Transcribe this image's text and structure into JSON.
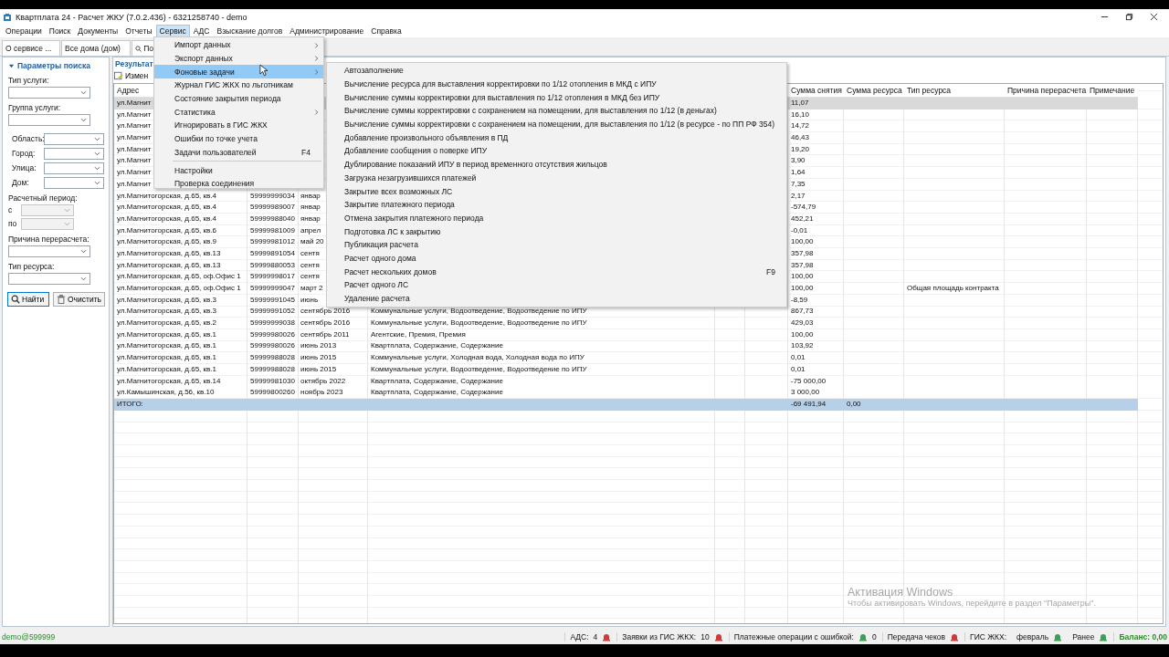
{
  "window": {
    "title": "Квартплата 24 - Расчет ЖКУ (7.0.2.436) - 6321258740 - demo"
  },
  "menu_bar": [
    {
      "label": "Операции",
      "selected": false
    },
    {
      "label": "Поиск",
      "selected": false
    },
    {
      "label": "Документы",
      "selected": false
    },
    {
      "label": "Отчеты",
      "selected": false
    },
    {
      "label": "Сервис",
      "selected": true
    },
    {
      "label": "АДС",
      "selected": false
    },
    {
      "label": "Взыскание долгов",
      "selected": false
    },
    {
      "label": "Администрирование",
      "selected": false
    },
    {
      "label": "Справка",
      "selected": false
    }
  ],
  "tabs": [
    {
      "label": "О сервисе ...",
      "kind": "plain"
    },
    {
      "label": "Все дома (дом)",
      "kind": "plain"
    },
    {
      "label": "По",
      "kind": "search"
    }
  ],
  "service_menu": [
    {
      "kind": "item",
      "label": "Импорт данных",
      "has_submenu": true,
      "selected": false
    },
    {
      "kind": "item",
      "label": "Экспорт данных",
      "has_submenu": true,
      "selected": false
    },
    {
      "kind": "item",
      "label": "Фоновые задачи",
      "has_submenu": true,
      "selected": true
    },
    {
      "kind": "item",
      "label": "Журнал ГИС ЖКХ по льготникам",
      "has_submenu": false,
      "selected": false
    },
    {
      "kind": "item",
      "label": "Состояние закрытия периода",
      "has_submenu": false,
      "selected": false
    },
    {
      "kind": "item",
      "label": "Статистика",
      "has_submenu": true,
      "selected": false
    },
    {
      "kind": "item",
      "label": "Игнорировать в ГИС ЖКХ",
      "has_submenu": false,
      "selected": false
    },
    {
      "kind": "item",
      "label": "Ошибки по точке учета",
      "has_submenu": false,
      "selected": false
    },
    {
      "kind": "item",
      "label": "Задачи пользователей",
      "shortcut": "F4",
      "has_submenu": false,
      "selected": false
    },
    {
      "kind": "separator"
    },
    {
      "kind": "item",
      "label": "Настройки",
      "has_submenu": false,
      "selected": false
    },
    {
      "kind": "item",
      "label": "Проверка соединения",
      "has_submenu": false,
      "selected": false
    }
  ],
  "background_tasks_menu": [
    {
      "label": "Автозаполнение"
    },
    {
      "label": "Вычисление ресурса для выставления корректировки по 1/12 отопления в МКД с ИПУ"
    },
    {
      "label": "Вычисление суммы корректировки  для выставления по 1/12 отопления в МКД без ИПУ"
    },
    {
      "label": "Вычисление суммы корректировки с сохранением на помещении, для выставления по 1/12 (в деньгах)"
    },
    {
      "label": "Вычисление суммы корректировки с сохранением на помещении, для выставления по 1/12 (в ресурсе - по ПП РФ 354)"
    },
    {
      "label": "Добавление произвольного объявления в ПД"
    },
    {
      "label": "Добавление сообщения о поверке ИПУ"
    },
    {
      "label": "Дублирование показаний ИПУ в период временного отсутствия жильцов"
    },
    {
      "label": "Загрузка незагрузившихся платежей"
    },
    {
      "label": "Закрытие всех возможных ЛС"
    },
    {
      "label": "Закрытие платежного периода"
    },
    {
      "label": "Отмена закрытия платежного периода"
    },
    {
      "label": "Подготовка ЛС к закрытию"
    },
    {
      "label": "Публикация расчета"
    },
    {
      "label": "Расчет  одного дома"
    },
    {
      "label": "Расчет нескольких домов",
      "shortcut": "F9"
    },
    {
      "label": "Расчет одного ЛС"
    },
    {
      "label": "Удаление расчета"
    }
  ],
  "search_panel": {
    "title": "Параметры поиска",
    "service_fields": [
      {
        "label": "Тип услуги:"
      },
      {
        "label": "Группа услуги:"
      }
    ],
    "address_fields": [
      {
        "label": "Область:"
      },
      {
        "label": "Город:"
      },
      {
        "label": "Улица:"
      },
      {
        "label": "Дом:"
      }
    ],
    "period": {
      "label": "Расчетный период:",
      "fields": [
        {
          "label": "с",
          "disabled": true
        },
        {
          "label": "по",
          "disabled": true
        }
      ]
    },
    "extra_fields": [
      {
        "label": "Причина перерасчета:"
      },
      {
        "label": "Тип ресурса:"
      }
    ],
    "buttons": [
      {
        "label": "Найти",
        "kind": "search"
      },
      {
        "label": "Очистить",
        "kind": "clear"
      }
    ]
  },
  "results": {
    "title": "Результат",
    "edit_button": "Измен",
    "table": {
      "columns": [
        "Адрес",
        "Сумма снятия",
        "Сумма ресурса",
        "Тип ресурса",
        "Причина перерасчета",
        "Примечание"
      ],
      "rows": [
        {
          "address": "ул.Магнит",
          "sum": "11,07",
          "selected": true
        },
        {
          "address": "ул.Магнит",
          "sum": "16,10",
          "selected": false
        },
        {
          "address": "ул.Магнит",
          "sum": "14,72",
          "selected": false
        },
        {
          "address": "ул.Магнит",
          "sum": "46,43",
          "selected": false
        },
        {
          "address": "ул.Магнит",
          "sum": "19,20",
          "selected": false
        },
        {
          "address": "ул.Магнит",
          "sum": "3,90",
          "selected": false
        },
        {
          "address": "ул.Магнит",
          "sum": "1,64",
          "selected": false
        },
        {
          "address": "ул.Магнит",
          "sum": "7,35",
          "selected": false
        },
        {
          "address": "ул.Магнитогорская, д.65, кв.4",
          "account": "59999999034",
          "period": "январ",
          "sum": "2,17",
          "selected": false
        },
        {
          "address": "ул.Магнитогорская, д.65, кв.4",
          "account": "59999989007",
          "period": "январ",
          "sum": "-574,79",
          "selected": false
        },
        {
          "address": "ул.Магнитогорская, д.65, кв.4",
          "account": "59999988040",
          "period": "январ",
          "sum": "452,21",
          "selected": false
        },
        {
          "address": "ул.Магнитогорская, д.65, кв.6",
          "account": "59999981009",
          "period": "апрел",
          "sum": "-0,01",
          "selected": false
        },
        {
          "address": "ул.Магнитогорская, д.65, кв.9",
          "account": "59999981012",
          "period": "май 20",
          "sum": "100,00",
          "selected": false
        },
        {
          "address": "ул.Магнитогорская, д.65, кв.13",
          "account": "59999891054",
          "period": "сентя",
          "sum": "357,98",
          "selected": false
        },
        {
          "address": "ул.Магнитогорская, д.65, кв.13",
          "account": "59999880053",
          "period": "сентя",
          "sum": "357,98",
          "selected": false
        },
        {
          "address": "ул.Магнитогорская, д.65, оф.Офис 1",
          "account": "59999998017",
          "period": "сентя",
          "sum": "100,00",
          "selected": false
        },
        {
          "address": "ул.Магнитогорская, д.65, оф.Офис 1",
          "account": "59999999047",
          "period": "март 2",
          "sum": "100,00",
          "resource_type": "Общая площадь контракта",
          "selected": false
        },
        {
          "address": "ул.Магнитогорская, д.65, кв.3",
          "account": "59999991045",
          "period": "июнь",
          "sum": "-8,59",
          "selected": false
        },
        {
          "address": "ул.Магнитогорская, д.65, кв.3",
          "account": "59999991052",
          "period": "сентябрь 2016",
          "services": "Коммунальные услуги, Водоотведение, Водоотведение по ИПУ",
          "sum": "867,73",
          "selected": false
        },
        {
          "address": "ул.Магнитогорская, д.65, кв.2",
          "account": "59999999038",
          "period": "сентябрь 2016",
          "services": "Коммунальные услуги, Водоотведение, Водоотведение по ИПУ",
          "sum": "429,03",
          "selected": false
        },
        {
          "address": "ул.Магнитогорская, д.65, кв.1",
          "account": "59999980026",
          "period": "сентябрь 2011",
          "services": "Агентские, Премия, Премия",
          "sum": "100,00",
          "selected": false
        },
        {
          "address": "ул.Магнитогорская, д.65, кв.1",
          "account": "59999980026",
          "period": "июнь 2013",
          "services": "Квартплата, Содержание, Содержание",
          "sum": "103,92",
          "selected": false
        },
        {
          "address": "ул.Магнитогорская, д.65, кв.1",
          "account": "59999988028",
          "period": "июнь 2015",
          "services": "Коммунальные услуги, Холодная вода, Холодная вода по ИПУ",
          "sum": "0,01",
          "selected": false
        },
        {
          "address": "ул.Магнитогорская, д.65, кв.1",
          "account": "59999988028",
          "period": "июнь 2015",
          "services": "Коммунальные услуги, Водоотведение, Водоотведение по ИПУ",
          "sum": "0,01",
          "selected": false
        },
        {
          "address": "ул.Магнитогорская, д.65, кв.14",
          "account": "59999981030",
          "period": "октябрь 2022",
          "services": "Квартплата, Содержание, Содержание",
          "sum": "-75 000,00",
          "selected": false
        },
        {
          "address": "ул.Камышинская, д.56, кв.10",
          "account": "59999800260",
          "period": "ноябрь 2023",
          "services": "Квартплата, Содержание, Содержание",
          "sum": "3 000,00",
          "selected": false
        }
      ],
      "total": {
        "label": "ИТОГО:",
        "sum": "-69 491,94",
        "resource_sum": "0,00"
      }
    }
  },
  "status_bar": {
    "user": "demo@599999",
    "indicators": [
      {
        "kind": "value_icon",
        "label": "АДС:",
        "value": "4",
        "color": "#d23a3a"
      },
      {
        "kind": "value_icon",
        "label": "Заявки из ГИС ЖКХ:",
        "value": "10",
        "color": "#d23a3a"
      },
      {
        "kind": "icon_value",
        "label": "Платежные операции с ошибкой:",
        "value": "0",
        "color": "#3aa055"
      },
      {
        "kind": "icon",
        "label": "Передача чеков",
        "color": "#d23a3a"
      },
      {
        "kind": "text",
        "label": "ГИС ЖКХ:"
      },
      {
        "kind": "icon",
        "label": "февраль",
        "color": "#3aa055"
      },
      {
        "kind": "icon",
        "label": "Ранее",
        "color": "#3aa055"
      }
    ],
    "balance": "Баланс: 0,00"
  },
  "os_notice": {
    "title": "Активация Windows",
    "text": "Чтобы активировать Windows, перейдите в раздел \"Параметры\"."
  }
}
